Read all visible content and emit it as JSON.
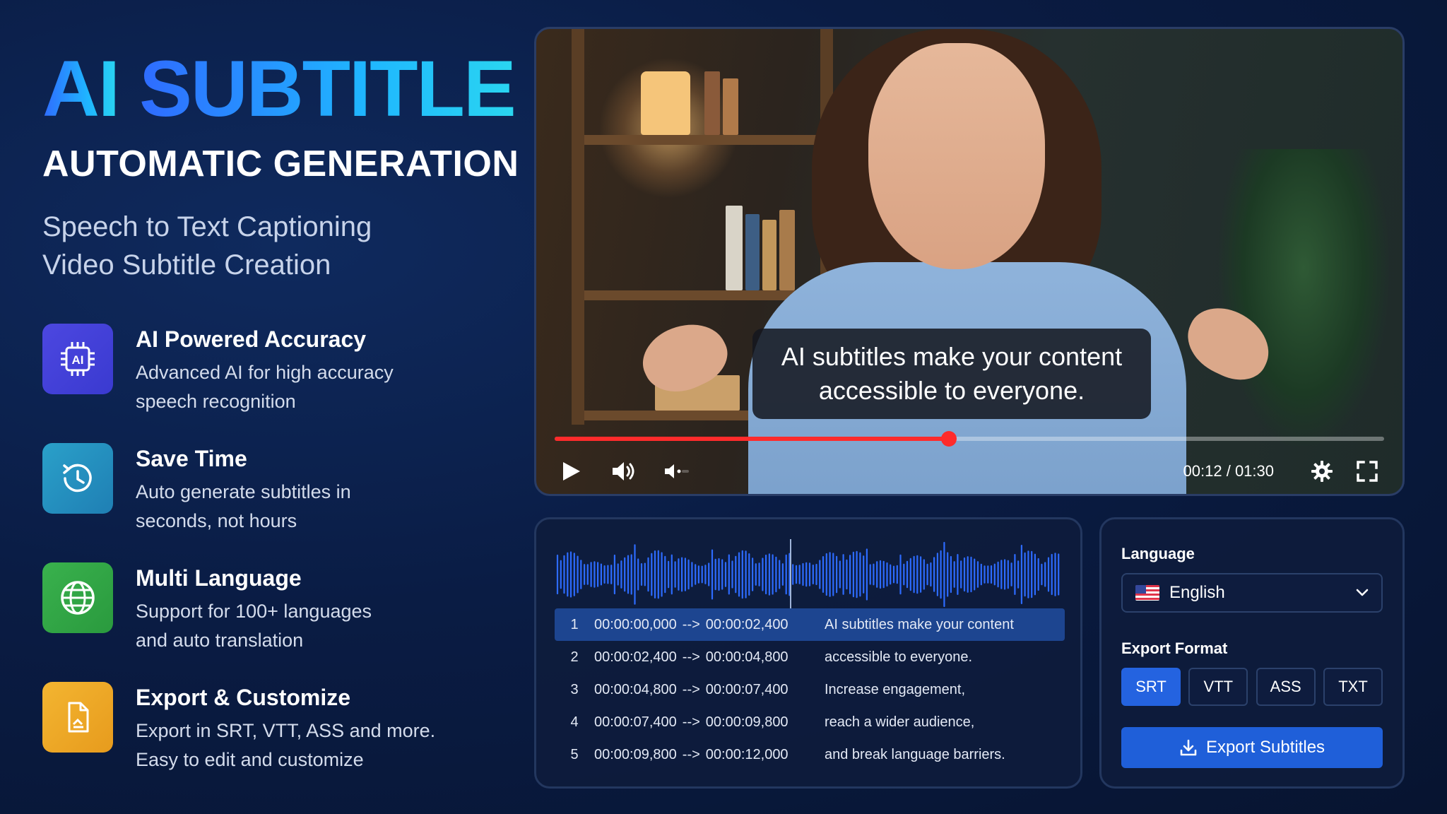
{
  "hero": {
    "title_prefix": "AI",
    "title_main": "SUBTITLE",
    "subtitle": "AUTOMATIC GENERATION",
    "tagline_1": "Speech to Text Captioning",
    "tagline_2": "Video Subtitle Creation"
  },
  "features": [
    {
      "icon": "ai-chip-icon",
      "title": "AI Powered Accuracy",
      "desc_1": "Advanced AI for high accuracy",
      "desc_2": "speech recognition",
      "chip_text": "AI"
    },
    {
      "icon": "clock-history-icon",
      "title": "Save Time",
      "desc_1": "Auto generate subtitles in",
      "desc_2": "seconds, not hours"
    },
    {
      "icon": "globe-icon",
      "title": "Multi Language",
      "desc_1": "Support for 100+ languages",
      "desc_2": "and auto translation"
    },
    {
      "icon": "export-file-icon",
      "title": "Export & Customize",
      "desc_1": "Export in SRT, VTT, ASS and more.",
      "desc_2": "Easy to edit and customize"
    }
  ],
  "player": {
    "caption_line_1": "AI subtitles make your content",
    "caption_line_2": "accessible to everyone.",
    "time_readout": "00:12 / 01:30",
    "progress": 0.475,
    "accent": "#ff2b2b"
  },
  "transcript": {
    "active_index": 0,
    "rows": [
      {
        "num": "1",
        "start": "00:00:00,000",
        "end": "00:00:02,400",
        "text": "AI subtitles make your content"
      },
      {
        "num": "2",
        "start": "00:00:02,400",
        "end": "00:00:04,800",
        "text": "accessible to everyone."
      },
      {
        "num": "3",
        "start": "00:00:04,800",
        "end": "00:00:07,400",
        "text": "Increase engagement,"
      },
      {
        "num": "4",
        "start": "00:00:07,400",
        "end": "00:00:09,800",
        "text": "reach a wider audience,"
      },
      {
        "num": "5",
        "start": "00:00:09,800",
        "end": "00:00:12,000",
        "text": "and break language barriers."
      }
    ],
    "arrow": "-->"
  },
  "settings": {
    "language_label": "Language",
    "language_value": "English",
    "format_label": "Export Format",
    "formats": [
      "SRT",
      "VTT",
      "ASS",
      "TXT"
    ],
    "selected_format": "SRT",
    "export_label": "Export Subtitles",
    "accent": "#1f5fd9"
  }
}
